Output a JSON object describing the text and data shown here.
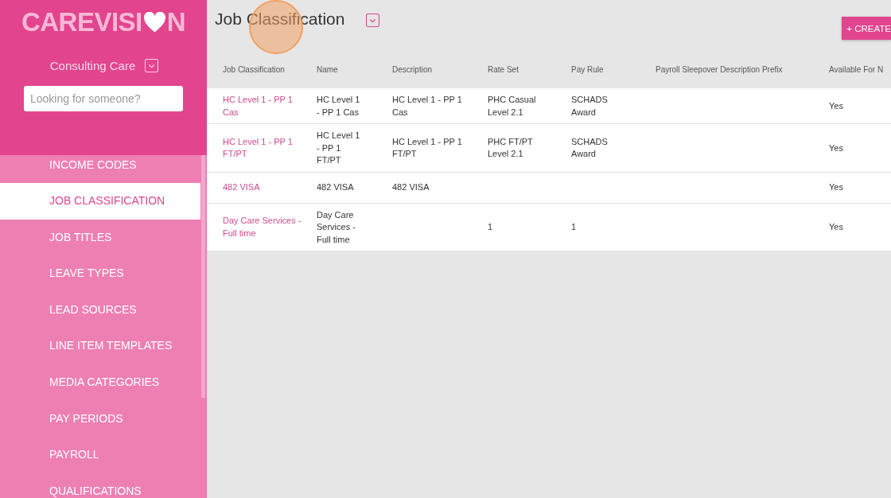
{
  "sidebar": {
    "logo": {
      "before": "CAREVISI",
      "after": "N"
    },
    "account": "Consulting Care",
    "search": {
      "placeholder": "Looking for someone?"
    },
    "items": [
      {
        "label": "INCOME CODES",
        "selected": false
      },
      {
        "label": "JOB CLASSIFICATION",
        "selected": true
      },
      {
        "label": "JOB TITLES",
        "selected": false
      },
      {
        "label": "LEAVE TYPES",
        "selected": false
      },
      {
        "label": "LEAD SOURCES",
        "selected": false
      },
      {
        "label": "LINE ITEM TEMPLATES",
        "selected": false
      },
      {
        "label": "MEDIA CATEGORIES",
        "selected": false
      },
      {
        "label": "PAY PERIODS",
        "selected": false
      },
      {
        "label": "PAYROLL",
        "selected": false
      },
      {
        "label": "QUALIFICATIONS",
        "selected": false
      }
    ]
  },
  "page": {
    "title": "Job Classification",
    "create_button": "+ CREATE"
  },
  "table": {
    "columns": [
      "Job Classification",
      "Name",
      "Description",
      "Rate Set",
      "Pay Rule",
      "Payroll Sleepover Description Prefix",
      "Available For N"
    ],
    "rows": [
      [
        "HC Level 1 - PP 1 Cas",
        "HC Level 1 - PP 1 Cas",
        "HC Level 1 - PP 1 Cas",
        "PHC Casual Level 2.1",
        "SCHADS Award",
        "",
        "Yes"
      ],
      [
        "HC Level 1 - PP 1 FT/PT",
        "HC Level 1 - PP 1 FT/PT",
        "HC Level 1 - PP 1 FT/PT",
        "PHC FT/PT Level 2.1",
        "SCHADS Award",
        "",
        "Yes"
      ],
      [
        "482 VISA",
        "482 VISA",
        "482 VISA",
        "",
        "",
        "",
        "Yes"
      ],
      [
        "Day Care Services - Full time",
        "Day Care Services - Full time",
        "",
        "1",
        "1",
        "",
        "Yes"
      ]
    ]
  }
}
